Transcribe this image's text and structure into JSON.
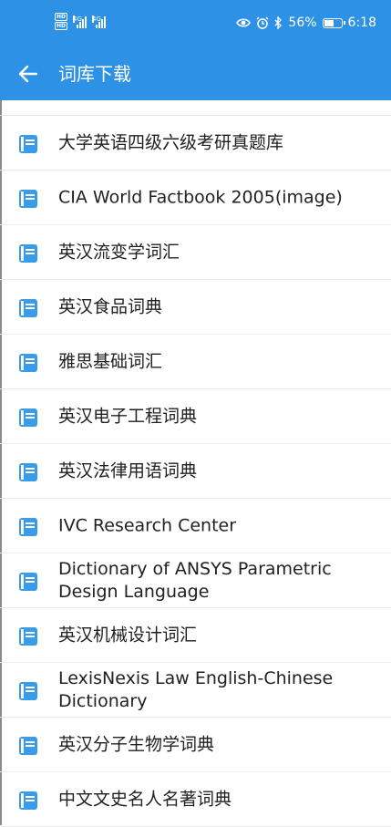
{
  "status_bar": {
    "hd1": "HD",
    "hd2": "HD",
    "net1": "4G",
    "net2": "4G",
    "battery_percent": "56%",
    "battery_level": 0.56,
    "time": "6:18"
  },
  "appbar": {
    "title": "词库下载"
  },
  "dictionaries": [
    "大学英语四级六级考研真题库",
    "CIA World Factbook 2005(image)",
    "英汉流变学词汇",
    "英汉食品词典",
    "雅思基础词汇",
    "英汉电子工程词典",
    "英汉法律用语词典",
    "IVC Research Center",
    "Dictionary of ANSYS Parametric Design Language",
    "英汉机械设计词汇",
    "LexisNexis Law English-Chinese Dictionary",
    "英汉分子生物学词典",
    "中文文史名人名著词典"
  ],
  "colors": {
    "primary": "#2d92e6",
    "icon": "#3a9be8"
  }
}
